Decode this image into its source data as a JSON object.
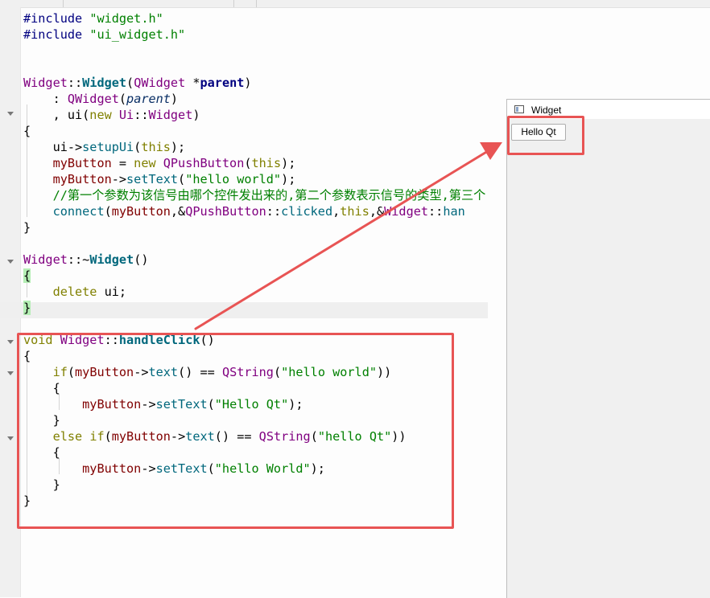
{
  "code_lines": {
    "l1": {
      "kw": "#include",
      "str": "\"widget.h\""
    },
    "l2": {
      "kw": "#include",
      "str": "\"ui_widget.h\""
    },
    "l5": {
      "cls": "Widget",
      "sep": "::",
      "fn": "Widget",
      "open": "(",
      "type": "QWidget",
      "ptr": " *",
      "param": "parent",
      "close": ")"
    },
    "l6": {
      "pre": ": ",
      "type": "QWidget",
      "open": "(",
      "param": "parent",
      "close": ")"
    },
    "l7": {
      "pre": ", ui(",
      "kw": "new",
      "sp": " ",
      "cls": "Ui",
      "sep": "::",
      "type": "Widget",
      "close": ")"
    },
    "l8": "{",
    "l9": {
      "pre": "ui->",
      "fn": "setupUi",
      "open": "(",
      "kw": "this",
      "close": ");"
    },
    "l10": {
      "var": "myButton",
      "eq": " = ",
      "kw": "new",
      "sp": " ",
      "type": "QPushButton",
      "open": "(",
      "kw2": "this",
      "close": ");"
    },
    "l11": {
      "var": "myButton",
      "arrow": "->",
      "fn": "setText",
      "open": "(",
      "str": "\"hello world\"",
      "close": ");"
    },
    "l12": "//第一个参数为该信号由哪个控件发出来的,第二个参数表示信号的类型,第三个",
    "l13": {
      "fn": "connect",
      "open": "(",
      "var": "myButton",
      "amp": ",&",
      "type": "QPushButton",
      "sep": "::",
      "fn2": "clicked",
      "comma": ",",
      "kw": "this",
      "amp2": ",&",
      "cls": "Widget",
      "sep2": "::",
      "fn3": "han"
    },
    "l14": "}",
    "l16": {
      "cls": "Widget",
      "sep": "::~",
      "fn": "Widget",
      "paren": "()"
    },
    "l17": "{",
    "l18": {
      "kw": "delete",
      "rest": " ui;"
    },
    "l19": "}",
    "l21": {
      "kw": "void",
      "sp": " ",
      "cls": "Widget",
      "sep": "::",
      "fn": "handleClick",
      "paren": "()"
    },
    "l22": "{",
    "l23": {
      "kw": "if",
      "open": "(",
      "var": "myButton",
      "arrow": "->",
      "fn": "text",
      "mid": "() == ",
      "type": "QString",
      "open2": "(",
      "str": "\"hello world\"",
      "close": "))"
    },
    "l24": "{",
    "l25": {
      "var": "myButton",
      "arrow": "->",
      "fn": "setText",
      "open": "(",
      "str": "\"Hello Qt\"",
      "close": ");"
    },
    "l26": "}",
    "l27": {
      "kw": "else",
      "sp": " ",
      "kw2": "if",
      "open": "(",
      "var": "myButton",
      "arrow": "->",
      "fn": "text",
      "mid": "() == ",
      "type": "QString",
      "open2": "(",
      "str": "\"hello Qt\"",
      "close": "))"
    },
    "l28": "{",
    "l29": {
      "var": "myButton",
      "arrow": "->",
      "fn": "setText",
      "open": "(",
      "str": "\"hello World\"",
      "close": ");"
    },
    "l30": "}",
    "l31": "}"
  },
  "widget_window": {
    "title": "Widget",
    "button_label": "Hello Qt"
  },
  "colors": {
    "annotation_red": "#e85454",
    "keyword": "#808000",
    "string": "#008000",
    "class": "#800080",
    "function": "#00677c"
  }
}
